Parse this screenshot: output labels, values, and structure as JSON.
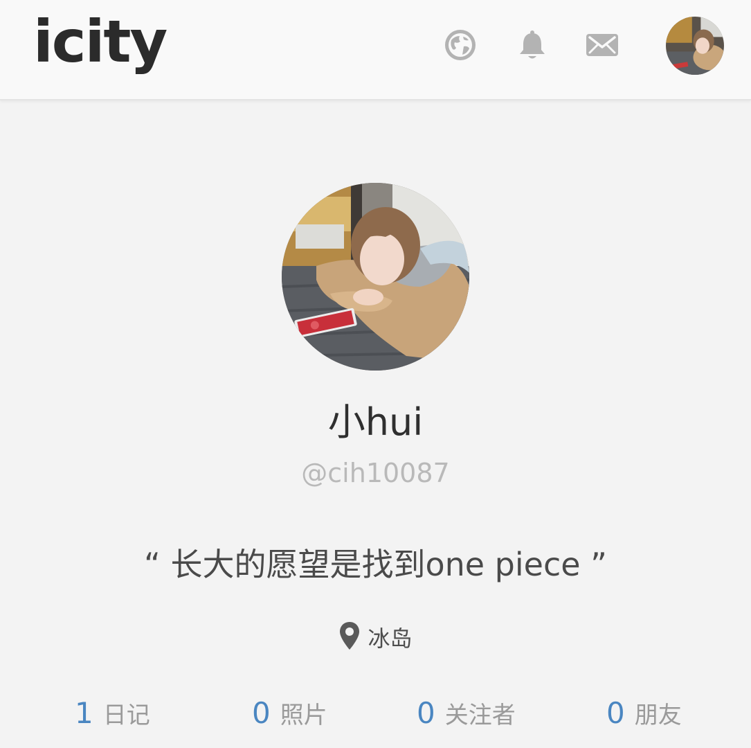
{
  "header": {
    "logo": "icity",
    "icons": [
      "globe-icon",
      "bell-icon",
      "mail-icon"
    ]
  },
  "profile": {
    "name": "小hui",
    "handle": "@cih10087",
    "bio": "“ 长大的愿望是找到one piece ”",
    "location": "冰岛",
    "location_icon": "map-pin-icon"
  },
  "stats": [
    {
      "count": "1",
      "label": "日记"
    },
    {
      "count": "0",
      "label": "照片"
    },
    {
      "count": "0",
      "label": "关注者"
    },
    {
      "count": "0",
      "label": "朋友"
    }
  ],
  "colors": {
    "accent": "#4a86c1",
    "background": "#f3f3f3",
    "header_bg": "#f9f9f9",
    "icon_gray": "#b3b3b3"
  }
}
